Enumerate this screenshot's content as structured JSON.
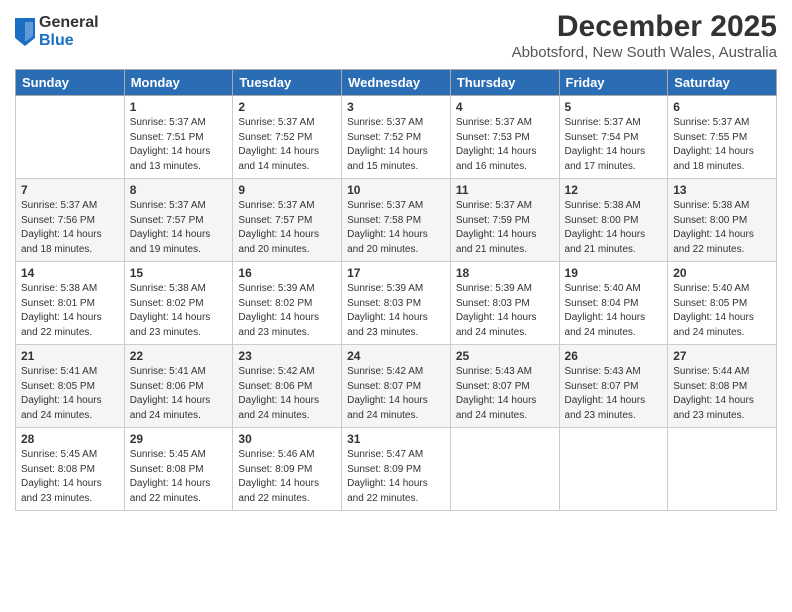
{
  "logo": {
    "general": "General",
    "blue": "Blue"
  },
  "header": {
    "month": "December 2025",
    "location": "Abbotsford, New South Wales, Australia"
  },
  "weekdays": [
    "Sunday",
    "Monday",
    "Tuesday",
    "Wednesday",
    "Thursday",
    "Friday",
    "Saturday"
  ],
  "weeks": [
    [
      {
        "day": "",
        "info": ""
      },
      {
        "day": "1",
        "info": "Sunrise: 5:37 AM\nSunset: 7:51 PM\nDaylight: 14 hours\nand 13 minutes."
      },
      {
        "day": "2",
        "info": "Sunrise: 5:37 AM\nSunset: 7:52 PM\nDaylight: 14 hours\nand 14 minutes."
      },
      {
        "day": "3",
        "info": "Sunrise: 5:37 AM\nSunset: 7:52 PM\nDaylight: 14 hours\nand 15 minutes."
      },
      {
        "day": "4",
        "info": "Sunrise: 5:37 AM\nSunset: 7:53 PM\nDaylight: 14 hours\nand 16 minutes."
      },
      {
        "day": "5",
        "info": "Sunrise: 5:37 AM\nSunset: 7:54 PM\nDaylight: 14 hours\nand 17 minutes."
      },
      {
        "day": "6",
        "info": "Sunrise: 5:37 AM\nSunset: 7:55 PM\nDaylight: 14 hours\nand 18 minutes."
      }
    ],
    [
      {
        "day": "7",
        "info": "Sunrise: 5:37 AM\nSunset: 7:56 PM\nDaylight: 14 hours\nand 18 minutes."
      },
      {
        "day": "8",
        "info": "Sunrise: 5:37 AM\nSunset: 7:57 PM\nDaylight: 14 hours\nand 19 minutes."
      },
      {
        "day": "9",
        "info": "Sunrise: 5:37 AM\nSunset: 7:57 PM\nDaylight: 14 hours\nand 20 minutes."
      },
      {
        "day": "10",
        "info": "Sunrise: 5:37 AM\nSunset: 7:58 PM\nDaylight: 14 hours\nand 20 minutes."
      },
      {
        "day": "11",
        "info": "Sunrise: 5:37 AM\nSunset: 7:59 PM\nDaylight: 14 hours\nand 21 minutes."
      },
      {
        "day": "12",
        "info": "Sunrise: 5:38 AM\nSunset: 8:00 PM\nDaylight: 14 hours\nand 21 minutes."
      },
      {
        "day": "13",
        "info": "Sunrise: 5:38 AM\nSunset: 8:00 PM\nDaylight: 14 hours\nand 22 minutes."
      }
    ],
    [
      {
        "day": "14",
        "info": "Sunrise: 5:38 AM\nSunset: 8:01 PM\nDaylight: 14 hours\nand 22 minutes."
      },
      {
        "day": "15",
        "info": "Sunrise: 5:38 AM\nSunset: 8:02 PM\nDaylight: 14 hours\nand 23 minutes."
      },
      {
        "day": "16",
        "info": "Sunrise: 5:39 AM\nSunset: 8:02 PM\nDaylight: 14 hours\nand 23 minutes."
      },
      {
        "day": "17",
        "info": "Sunrise: 5:39 AM\nSunset: 8:03 PM\nDaylight: 14 hours\nand 23 minutes."
      },
      {
        "day": "18",
        "info": "Sunrise: 5:39 AM\nSunset: 8:03 PM\nDaylight: 14 hours\nand 24 minutes."
      },
      {
        "day": "19",
        "info": "Sunrise: 5:40 AM\nSunset: 8:04 PM\nDaylight: 14 hours\nand 24 minutes."
      },
      {
        "day": "20",
        "info": "Sunrise: 5:40 AM\nSunset: 8:05 PM\nDaylight: 14 hours\nand 24 minutes."
      }
    ],
    [
      {
        "day": "21",
        "info": "Sunrise: 5:41 AM\nSunset: 8:05 PM\nDaylight: 14 hours\nand 24 minutes."
      },
      {
        "day": "22",
        "info": "Sunrise: 5:41 AM\nSunset: 8:06 PM\nDaylight: 14 hours\nand 24 minutes."
      },
      {
        "day": "23",
        "info": "Sunrise: 5:42 AM\nSunset: 8:06 PM\nDaylight: 14 hours\nand 24 minutes."
      },
      {
        "day": "24",
        "info": "Sunrise: 5:42 AM\nSunset: 8:07 PM\nDaylight: 14 hours\nand 24 minutes."
      },
      {
        "day": "25",
        "info": "Sunrise: 5:43 AM\nSunset: 8:07 PM\nDaylight: 14 hours\nand 24 minutes."
      },
      {
        "day": "26",
        "info": "Sunrise: 5:43 AM\nSunset: 8:07 PM\nDaylight: 14 hours\nand 23 minutes."
      },
      {
        "day": "27",
        "info": "Sunrise: 5:44 AM\nSunset: 8:08 PM\nDaylight: 14 hours\nand 23 minutes."
      }
    ],
    [
      {
        "day": "28",
        "info": "Sunrise: 5:45 AM\nSunset: 8:08 PM\nDaylight: 14 hours\nand 23 minutes."
      },
      {
        "day": "29",
        "info": "Sunrise: 5:45 AM\nSunset: 8:08 PM\nDaylight: 14 hours\nand 22 minutes."
      },
      {
        "day": "30",
        "info": "Sunrise: 5:46 AM\nSunset: 8:09 PM\nDaylight: 14 hours\nand 22 minutes."
      },
      {
        "day": "31",
        "info": "Sunrise: 5:47 AM\nSunset: 8:09 PM\nDaylight: 14 hours\nand 22 minutes."
      },
      {
        "day": "",
        "info": ""
      },
      {
        "day": "",
        "info": ""
      },
      {
        "day": "",
        "info": ""
      }
    ]
  ]
}
